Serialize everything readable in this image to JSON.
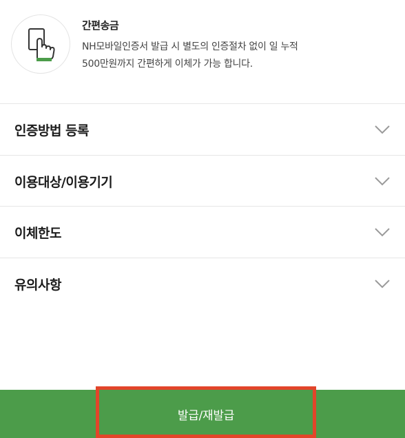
{
  "intro": {
    "icon": "touch-hand-icon",
    "title": "간편송금",
    "description_line1": "NH모바일인증서 발급 시 별도의 인증절차 없이 일 누적",
    "description_line2": "500만원까지 간편하게 이체가 가능 합니다."
  },
  "accordion": {
    "items": [
      {
        "label": "인증방법 등록",
        "icon": "chevron-down-icon"
      },
      {
        "label": "이용대상/이용기기",
        "icon": "chevron-down-icon"
      },
      {
        "label": "이체한도",
        "icon": "chevron-down-icon"
      },
      {
        "label": "유의사항",
        "icon": "chevron-down-icon"
      }
    ]
  },
  "footer": {
    "issue_button_label": "발급/재발급"
  },
  "colors": {
    "brand_green": "#4c9c4a",
    "highlight_red": "#e2452a"
  }
}
